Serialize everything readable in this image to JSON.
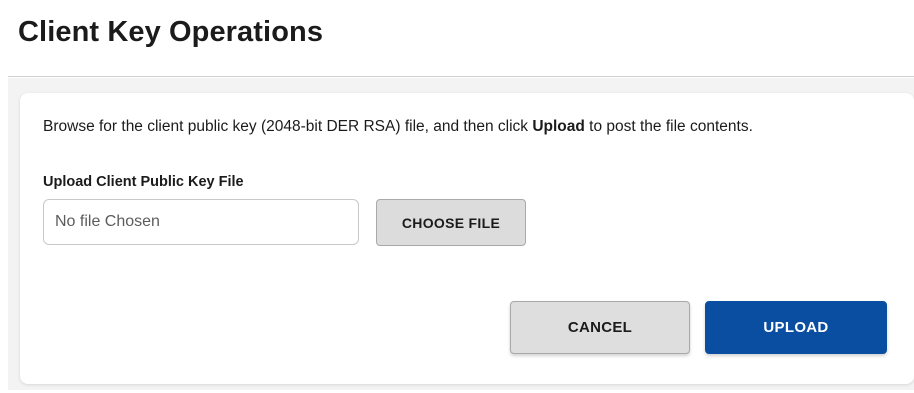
{
  "page": {
    "title": "Client Key Operations"
  },
  "card": {
    "instructions_prefix": "Browse for the client public key (2048-bit DER RSA) file, and then click ",
    "instructions_bold": "Upload",
    "instructions_suffix": " to post the file contents."
  },
  "upload_field": {
    "label": "Upload Client Public Key File",
    "placeholder": "No file Chosen",
    "value": "",
    "choose_button_label": "CHOOSE FILE"
  },
  "actions": {
    "cancel_label": "CANCEL",
    "upload_label": "UPLOAD"
  },
  "colors": {
    "primary": "#0a4ea2",
    "secondary_button": "#dedede",
    "panel_background": "#f3f3f3"
  }
}
